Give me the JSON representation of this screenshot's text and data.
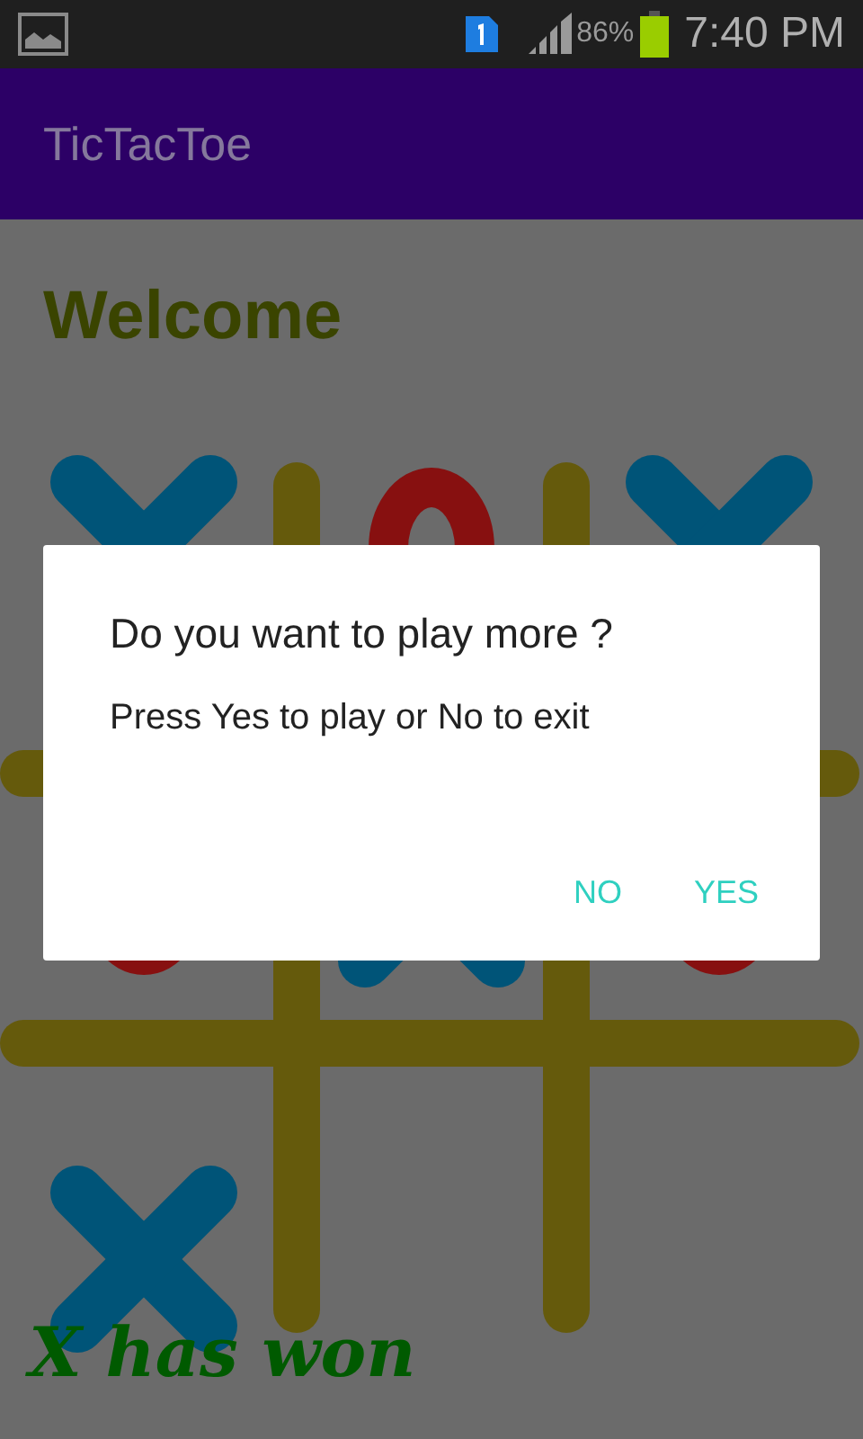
{
  "status_bar": {
    "battery": "86%",
    "time": "7:40 PM"
  },
  "app_bar": {
    "title": "TicTacToe"
  },
  "heading": "Welcome",
  "board": {
    "cells": [
      {
        "kind": "x"
      },
      {
        "kind": "o"
      },
      {
        "kind": "x"
      },
      {
        "kind": "o"
      },
      {
        "kind": "x"
      },
      {
        "kind": "o"
      },
      {
        "kind": "x"
      },
      {
        "kind": "empty"
      },
      {
        "kind": "empty"
      }
    ]
  },
  "result": "X has won",
  "dialog": {
    "title": "Do you want to play more ?",
    "message": "Press Yes to play or No to exit",
    "buttons": [
      {
        "label": "NO"
      },
      {
        "label": "YES"
      }
    ]
  }
}
